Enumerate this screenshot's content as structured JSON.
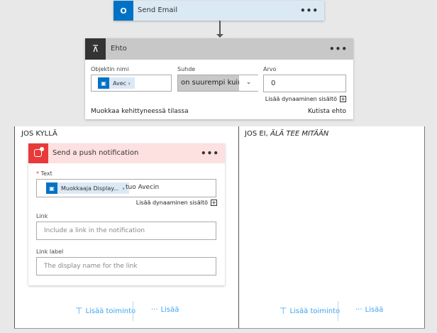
{
  "send_email": {
    "title": "Send Email",
    "more": "•••",
    "icon": "outlook-icon"
  },
  "condition": {
    "title": "Ehto",
    "more": "•••",
    "icon": "condition-icon",
    "object_label": "Objektin nimi",
    "object_token": "Avec",
    "relation_label": "Suhde",
    "relation_value": "on suurempi kuin",
    "value_label": "Arvo",
    "value": "0",
    "add_dynamic": "Lisää dynaaminen sisältö",
    "advanced_mode": "Muokkaa kehittyneessä tilassa",
    "collapse": "Kutista ehto"
  },
  "yes_branch": {
    "title": "JOS KYLLÄ",
    "push": {
      "title": "Send a push notification",
      "more": "•••",
      "icon": "notification-icon",
      "text_label": "Text",
      "required_mark": "*",
      "text_token": "Muokkaaja Display...",
      "text_suffix": "tuo Avecin",
      "add_dynamic": "Lisää dynaaminen sisältö",
      "link_label": "Link",
      "link_placeholder": "Include a link in the notification",
      "link_label_label": "Link label",
      "link_label_placeholder": "The display name for the link"
    },
    "add_action": "Lisää toiminto",
    "more": "Lisää"
  },
  "no_branch": {
    "title_prefix": "JOS EI, ",
    "title_italic": "ÄLÄ TEE MITÄÄN",
    "add_action": "Lisää toiminto",
    "more": "Lisää"
  },
  "colors": {
    "outlook": "#0072c6",
    "push": "#e83a3a",
    "link": "#3ba3f0"
  }
}
